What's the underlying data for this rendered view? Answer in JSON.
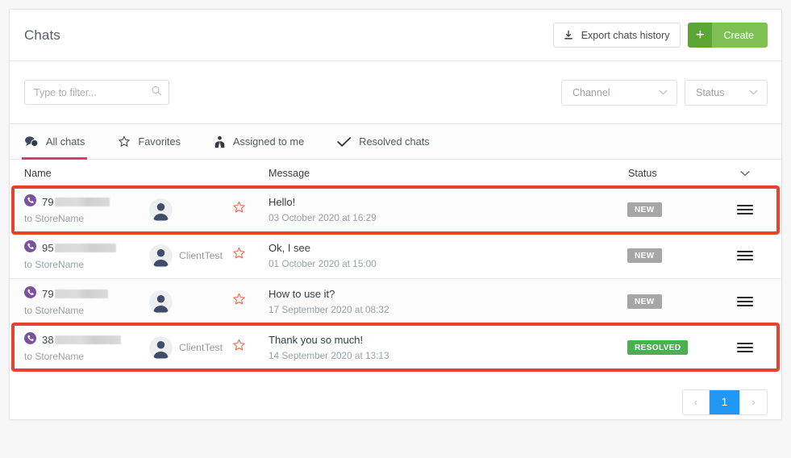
{
  "header": {
    "title": "Chats",
    "export_label": "Export chats history",
    "export_icon": "download-icon",
    "create_label": "Create",
    "create_plus": "+",
    "create_color": "#7dc155"
  },
  "filters": {
    "search_placeholder": "Type to filter...",
    "search_value": "",
    "search_icon": "search-icon",
    "channel_label": "Channel",
    "status_label": "Status"
  },
  "tabs": [
    {
      "label": "All chats",
      "icon": "chat-bubbles-icon",
      "active": true
    },
    {
      "label": "Favorites",
      "icon": "star-outline-icon",
      "active": false
    },
    {
      "label": "Assigned to me",
      "icon": "user-badge-icon",
      "active": false
    },
    {
      "label": "Resolved chats",
      "icon": "check-icon",
      "active": false
    }
  ],
  "table": {
    "columns": {
      "name": "Name",
      "message": "Message",
      "status": "Status",
      "sort_icon": "chevron-down-icon"
    },
    "rows": [
      {
        "channel_icon": "viber-icon",
        "phone_prefix": "79",
        "phone_redacted": true,
        "store": "to StoreName",
        "avatar": "avatar-person-icon",
        "client_name": "",
        "favorite_icon": "star-outline-icon",
        "message": "Hello!",
        "date": "03 October 2020 at 16:29",
        "status": "NEW",
        "status_kind": "new",
        "menu_icon": "hamburger-menu-icon",
        "highlighted": true
      },
      {
        "channel_icon": "viber-icon",
        "phone_prefix": "95",
        "phone_redacted": true,
        "store": "to StoreName",
        "avatar": "avatar-person-icon",
        "client_name": "ClientTest",
        "favorite_icon": "star-outline-icon",
        "message": "Ok, I see",
        "date": "01 October 2020 at 15:00",
        "status": "NEW",
        "status_kind": "new",
        "menu_icon": "hamburger-menu-icon",
        "highlighted": false
      },
      {
        "channel_icon": "viber-icon",
        "phone_prefix": "79",
        "phone_redacted": true,
        "store": "to StoreName",
        "avatar": "avatar-person-icon",
        "client_name": "",
        "favorite_icon": "star-outline-icon",
        "message": "How to use it?",
        "date": "17 September 2020 at 08:32",
        "status": "NEW",
        "status_kind": "new",
        "menu_icon": "hamburger-menu-icon",
        "highlighted": false
      },
      {
        "channel_icon": "viber-icon",
        "phone_prefix": "38",
        "phone_redacted": true,
        "store": "to StoreName",
        "avatar": "avatar-person-icon",
        "client_name": "ClientTest",
        "favorite_icon": "star-outline-icon",
        "message": "Thank you so much!",
        "date": "14 September 2020 at 13:13",
        "status": "RESOLVED",
        "status_kind": "resolved",
        "menu_icon": "hamburger-menu-icon",
        "highlighted": true
      }
    ]
  },
  "pagination": {
    "prev": "‹",
    "current": "1",
    "next": "›"
  },
  "colors": {
    "accent_tab": "#e8336d",
    "create_green": "#7dc155",
    "badge_new": "#a6a6a6",
    "badge_resolved": "#4caf50",
    "page_active": "#2196f3",
    "highlight_outline": "#e8412e",
    "viber_purple": "#7b519d"
  }
}
